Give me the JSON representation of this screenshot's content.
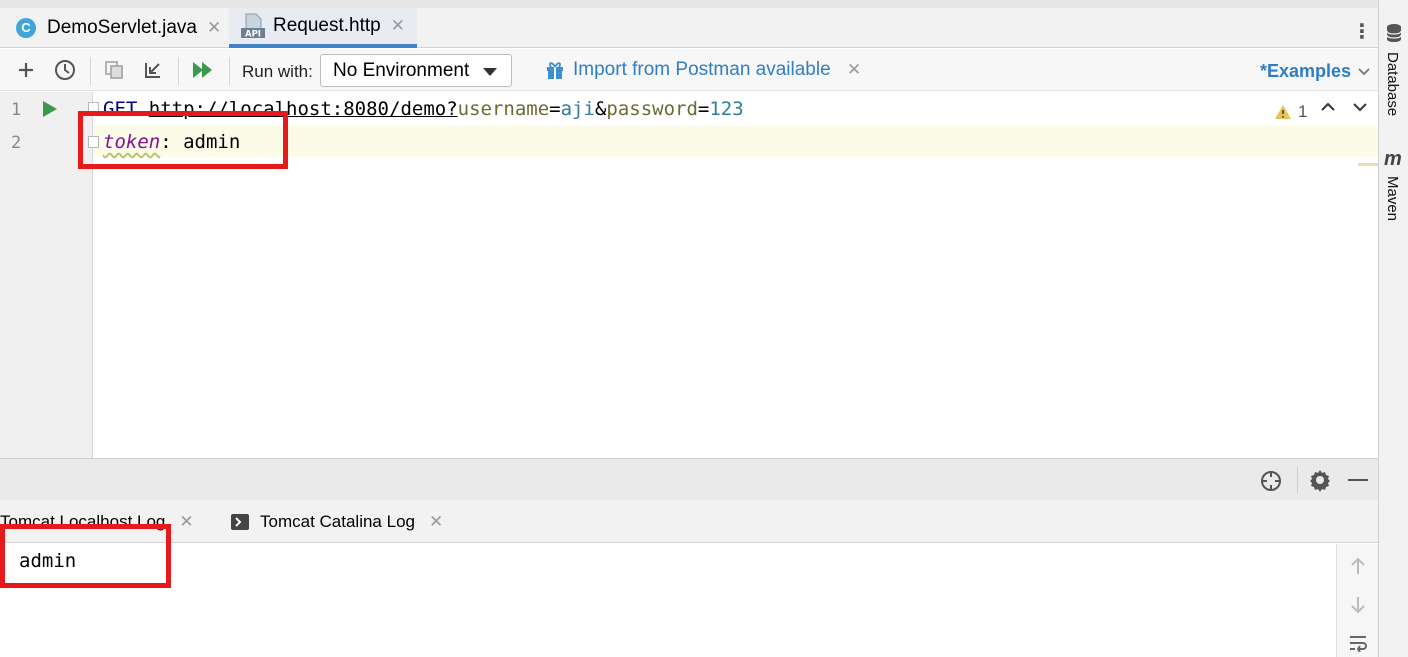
{
  "tabs": [
    {
      "label": "DemoServlet.java",
      "icon": "c-class-icon",
      "active": false
    },
    {
      "label": "Request.http",
      "icon": "api-file-icon",
      "active": true
    }
  ],
  "toolbar": {
    "run_with_label": "Run with:",
    "environment": "No Environment",
    "import_link": "Import from Postman available",
    "examples": "*Examples"
  },
  "editor": {
    "lines": [
      {
        "number": "1",
        "method": "GET",
        "url": "http://localhost:8080/demo?",
        "params": [
          {
            "name": "username",
            "value": "aji"
          },
          {
            "name": "password",
            "value": "123"
          }
        ]
      },
      {
        "number": "2",
        "header_name": "token",
        "header_value": "admin"
      }
    ],
    "warning_count": "1"
  },
  "bottom_panel": {
    "tabs": [
      "Tomcat Localhost Log",
      "Tomcat Catalina Log"
    ],
    "console_output": "admin"
  },
  "right_sidebar": {
    "items": [
      "Database",
      "Maven"
    ]
  },
  "colors": {
    "accent": "#2f7ec4",
    "highlight_box": "#e61a1a",
    "run_green": "#3b9a4a"
  }
}
